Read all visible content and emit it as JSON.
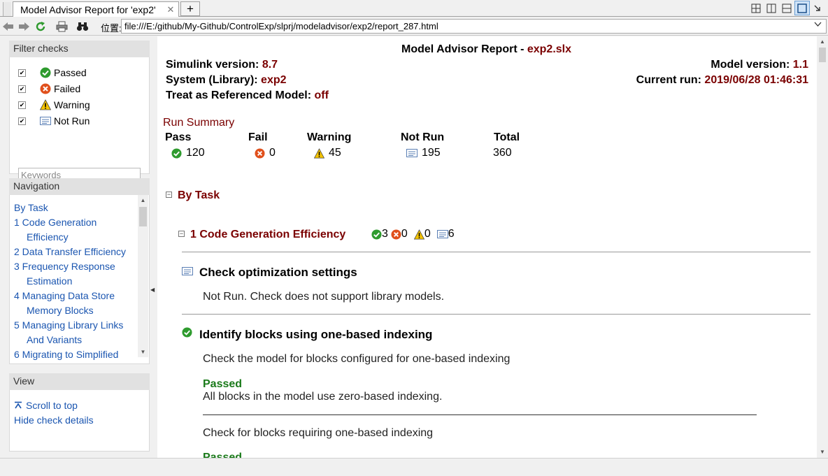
{
  "browser": {
    "tab_title": "Model Advisor Report for 'exp2'",
    "tab_close": "✕",
    "new_tab": "+",
    "address_label": "位置:",
    "address_url": "file:///E:/github/My-Github/ControlExp/slprj/modeladvisor/exp2/report_287.html"
  },
  "sidebar": {
    "filter_title": "Filter checks",
    "filters": [
      {
        "label": "Passed",
        "icon": "pass-icon",
        "checked": true
      },
      {
        "label": "Failed",
        "icon": "fail-icon",
        "checked": true
      },
      {
        "label": "Warning",
        "icon": "warning-icon",
        "checked": true
      },
      {
        "label": "Not Run",
        "icon": "not-run-icon",
        "checked": true
      }
    ],
    "keywords_placeholder": "Keywords",
    "navigation_title": "Navigation",
    "nav_items": [
      "By Task",
      "1 Code Generation",
      "Efficiency",
      "2 Data Transfer Efficiency",
      "3 Frequency Response",
      "Estimation",
      "4 Managing Data Store",
      "Memory Blocks",
      "5 Managing Library Links",
      "And Variants",
      "6 Migrating to Simplified"
    ],
    "view_title": "View",
    "scroll_to_top": "Scroll to top",
    "hide_check_details": "Hide check details"
  },
  "report": {
    "title_prefix": "Model Advisor Report - ",
    "title_model": "exp2.slx",
    "simulink_label": "Simulink version: ",
    "simulink_value": "8.7",
    "system_label": "System (Library): ",
    "system_value": "exp2",
    "treat_label": "Treat as Referenced Model: ",
    "treat_value": "off",
    "model_version_label": "Model version: ",
    "model_version_value": "1.1",
    "current_run_label": "Current run: ",
    "current_run_value": "2019/06/28 01:46:31",
    "run_summary_title": "Run Summary",
    "summary": [
      {
        "label": "Pass",
        "value": "120",
        "icon": "pass-icon"
      },
      {
        "label": "Fail",
        "value": "0",
        "icon": "fail-icon"
      },
      {
        "label": "Warning",
        "value": "45",
        "icon": "warning-icon"
      },
      {
        "label": "Not Run",
        "value": "195",
        "icon": "not-run-icon"
      },
      {
        "label": "Total",
        "value": "360",
        "icon": ""
      }
    ],
    "by_task_title": "By Task",
    "task_title": "1 Code Generation Efficiency",
    "task_counts": {
      "pass": "3",
      "fail": "0",
      "warning": "0",
      "not_run": "6"
    },
    "check1_title": "Check optimization settings",
    "check1_text": "Not Run. Check does not support library models.",
    "check2_title": "Identify blocks using one-based indexing",
    "check2_sub1": "Check the model for blocks configured for one-based indexing",
    "check2_status1": "Passed",
    "check2_result1": "All blocks in the model use zero-based indexing.",
    "check2_sub2": "Check for blocks requiring one-based indexing",
    "check2_status2": "Passed"
  },
  "colors": {
    "label_red": "#7a0000",
    "link_blue": "#1a55b0",
    "pass_green": "#1a7a1a"
  }
}
